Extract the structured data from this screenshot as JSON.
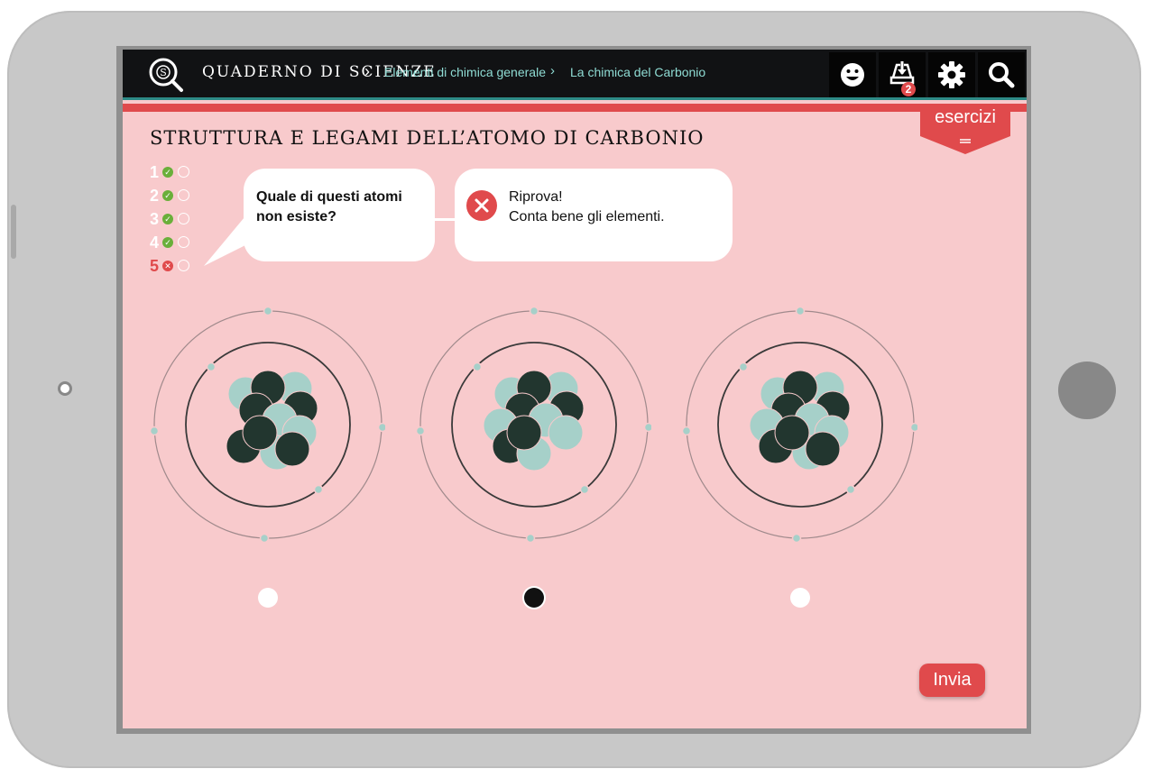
{
  "header": {
    "app_title": "QUADERNO DI SCIENZE",
    "main_separator": "›",
    "breadcrumbs": [
      "Elementi di chimica generale",
      "La chimica del Carbonio"
    ],
    "crumb_separator": "›",
    "download_badge": "2",
    "icons": [
      "smiley-icon",
      "download-icon",
      "gear-icon",
      "search-icon"
    ]
  },
  "tab": {
    "label": "esercizi"
  },
  "page": {
    "title": "STRUTTURA E LEGAMI DELL’ATOMO DI CARBONIO"
  },
  "progress": [
    {
      "num": "1",
      "status": "correct",
      "mark": "✓"
    },
    {
      "num": "2",
      "status": "correct",
      "mark": "✓"
    },
    {
      "num": "3",
      "status": "correct",
      "mark": "✓"
    },
    {
      "num": "4",
      "status": "correct",
      "mark": "✓"
    },
    {
      "num": "5",
      "status": "wrong",
      "mark": "✕"
    }
  ],
  "question": {
    "text": "Quale di questi atomi non esiste?"
  },
  "feedback": {
    "line1": "Riprova!",
    "line2": "Conta bene gli elementi."
  },
  "options": [
    {
      "selected": false
    },
    {
      "selected": true
    },
    {
      "selected": false
    }
  ],
  "submit": {
    "label": "Invia"
  },
  "colors": {
    "accent_red": "#e04a4c",
    "background_pink": "#f8cacc",
    "topbar": "#111214",
    "breadcrumb_teal": "#8fdcd4",
    "check_green": "#6aaf3a",
    "neutron": "#a6d0c9",
    "proton": "#22362f"
  }
}
